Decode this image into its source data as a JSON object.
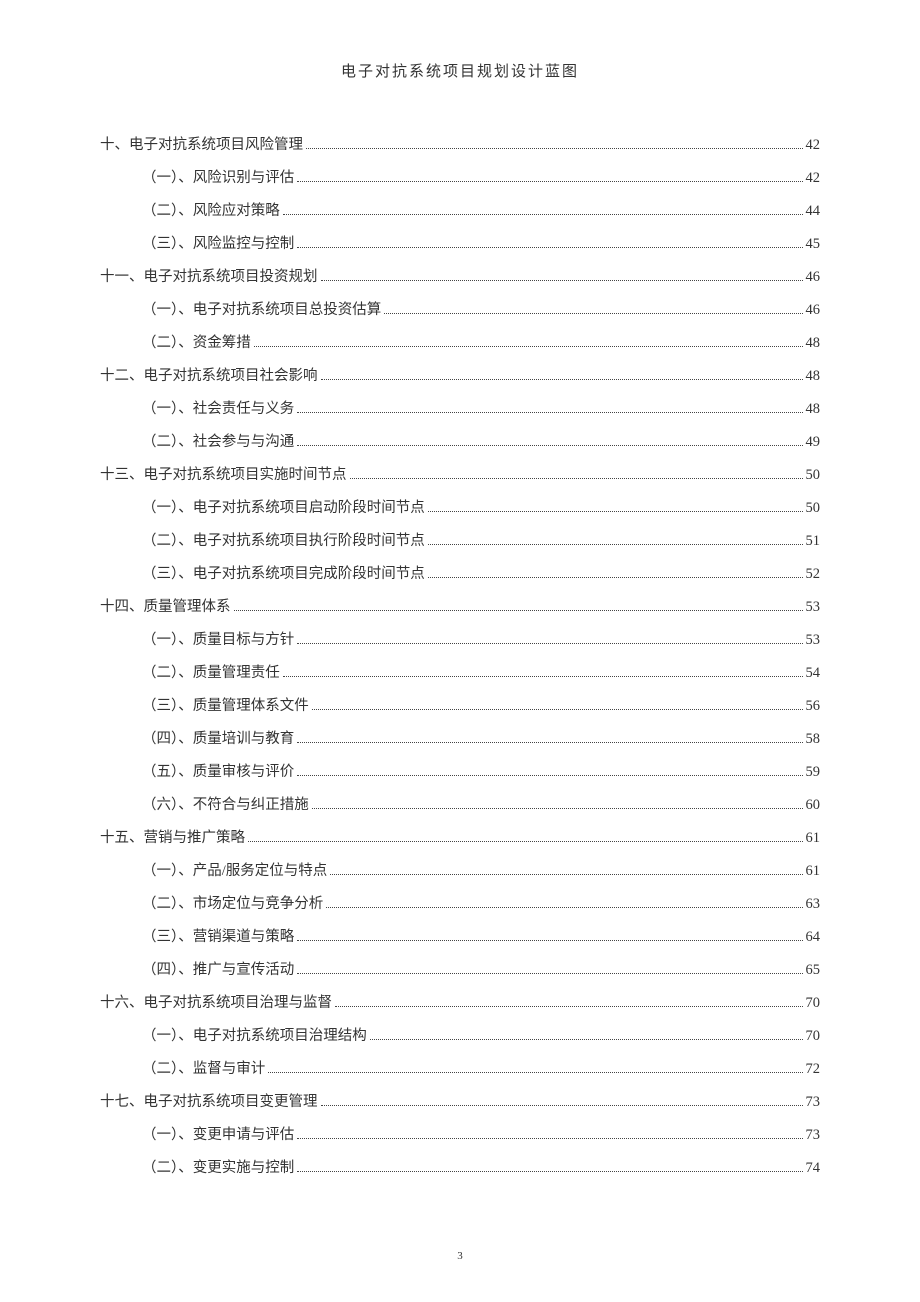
{
  "header": {
    "title": "电子对抗系统项目规划设计蓝图"
  },
  "footer": {
    "page_number": "3"
  },
  "toc": [
    {
      "level": 1,
      "label": "十、电子对抗系统项目风险管理",
      "page": "42"
    },
    {
      "level": 2,
      "label": "（一）、风险识别与评估",
      "page": "42"
    },
    {
      "level": 2,
      "label": "（二）、风险应对策略",
      "page": "44"
    },
    {
      "level": 2,
      "label": "（三）、风险监控与控制",
      "page": "45"
    },
    {
      "level": 1,
      "label": "十一、电子对抗系统项目投资规划",
      "page": "46"
    },
    {
      "level": 2,
      "label": "（一）、电子对抗系统项目总投资估算",
      "page": "46"
    },
    {
      "level": 2,
      "label": "（二）、资金筹措",
      "page": "48"
    },
    {
      "level": 1,
      "label": "十二、电子对抗系统项目社会影响",
      "page": "48"
    },
    {
      "level": 2,
      "label": "（一）、社会责任与义务",
      "page": "48"
    },
    {
      "level": 2,
      "label": "（二）、社会参与与沟通",
      "page": "49"
    },
    {
      "level": 1,
      "label": "十三、电子对抗系统项目实施时间节点",
      "page": "50"
    },
    {
      "level": 2,
      "label": "（一）、电子对抗系统项目启动阶段时间节点",
      "page": "50"
    },
    {
      "level": 2,
      "label": "（二）、电子对抗系统项目执行阶段时间节点",
      "page": "51"
    },
    {
      "level": 2,
      "label": "（三）、电子对抗系统项目完成阶段时间节点",
      "page": "52"
    },
    {
      "level": 1,
      "label": "十四、质量管理体系",
      "page": "53"
    },
    {
      "level": 2,
      "label": "（一）、质量目标与方针",
      "page": "53"
    },
    {
      "level": 2,
      "label": "（二）、质量管理责任",
      "page": "54"
    },
    {
      "level": 2,
      "label": "（三）、质量管理体系文件",
      "page": "56"
    },
    {
      "level": 2,
      "label": "（四）、质量培训与教育",
      "page": "58"
    },
    {
      "level": 2,
      "label": "（五）、质量审核与评价",
      "page": "59"
    },
    {
      "level": 2,
      "label": "（六）、不符合与纠正措施",
      "page": "60"
    },
    {
      "level": 1,
      "label": "十五、营销与推广策略",
      "page": "61"
    },
    {
      "level": 2,
      "label": "（一）、产品/服务定位与特点",
      "page": "61"
    },
    {
      "level": 2,
      "label": "（二）、市场定位与竞争分析",
      "page": "63"
    },
    {
      "level": 2,
      "label": "（三）、营销渠道与策略",
      "page": "64"
    },
    {
      "level": 2,
      "label": "（四）、推广与宣传活动",
      "page": "65"
    },
    {
      "level": 1,
      "label": "十六、电子对抗系统项目治理与监督",
      "page": "70"
    },
    {
      "level": 2,
      "label": "（一）、电子对抗系统项目治理结构",
      "page": "70"
    },
    {
      "level": 2,
      "label": "（二）、监督与审计",
      "page": "72"
    },
    {
      "level": 1,
      "label": "十七、电子对抗系统项目变更管理",
      "page": "73"
    },
    {
      "level": 2,
      "label": "（一）、变更申请与评估",
      "page": "73"
    },
    {
      "level": 2,
      "label": "（二）、变更实施与控制",
      "page": "74"
    }
  ]
}
